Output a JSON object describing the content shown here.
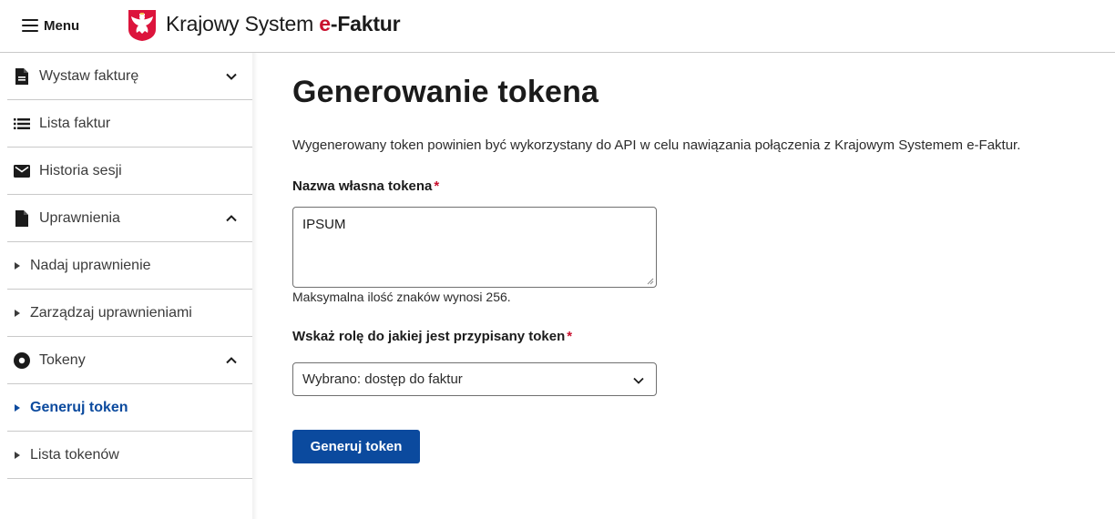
{
  "header": {
    "menu_label": "Menu",
    "brand_prefix": "Krajowy System ",
    "brand_e": "e",
    "brand_suffix": "-Faktur"
  },
  "sidebar": {
    "items": [
      {
        "label": "Wystaw fakturę",
        "icon": "document-icon",
        "expanded": false
      },
      {
        "label": "Lista faktur",
        "icon": "list-icon"
      },
      {
        "label": "Historia sesji",
        "icon": "envelope-icon"
      },
      {
        "label": "Uprawnienia",
        "icon": "file-icon",
        "expanded": true
      },
      {
        "label": "Nadaj uprawnienie",
        "sub": true
      },
      {
        "label": "Zarządzaj uprawnieniami",
        "sub": true
      },
      {
        "label": "Tokeny",
        "icon": "token-icon",
        "expanded": true
      },
      {
        "label": "Generuj token",
        "sub": true,
        "active": true
      },
      {
        "label": "Lista tokenów",
        "sub": true
      }
    ]
  },
  "main": {
    "title": "Generowanie tokena",
    "intro": "Wygenerowany token powinien być wykorzystany do API w celu nawiązania połączenia z Krajowym Systemem e-Faktur.",
    "token_name_label": "Nazwa własna tokena",
    "required_mark": "*",
    "token_name_value": "IPSUM",
    "token_name_hint": "Maksymalna ilość znaków wynosi 256.",
    "role_label": "Wskaż rolę do jakiej jest przypisany token",
    "role_selected": "Wybrano: dostęp do faktur",
    "submit_label": "Generuj token"
  },
  "colors": {
    "accent": "#0b4a9e",
    "required": "#c8102e",
    "border": "#c9c9c9"
  }
}
